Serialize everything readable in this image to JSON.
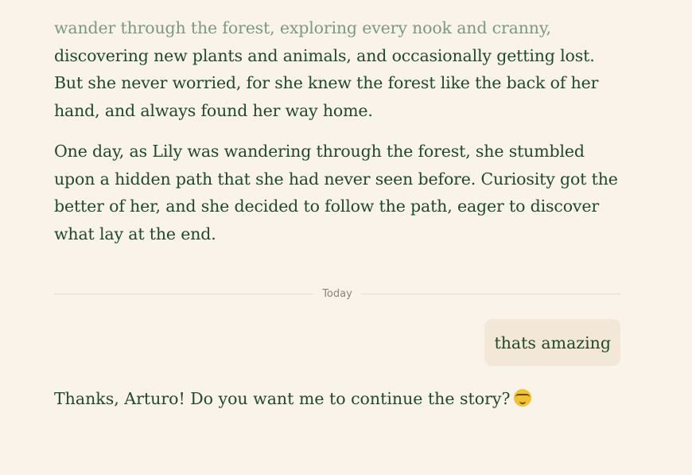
{
  "messages": {
    "assistant_story": {
      "faded_line": "wander through the forest, exploring every nook and cranny,",
      "paragraph1_rest": "discovering new plants and animals, and occasionally getting lost. But she never worried, for she knew the forest like the back of her hand, and always found her way home.",
      "paragraph2": "One day, as Lily was wandering through the forest, she stumbled upon a hidden path that she had never seen before. Curiosity got the better of her, and she decided to follow the path, eager to discover what lay at the end."
    },
    "divider_label": "Today",
    "user_message": "thats amazing",
    "assistant_reply": "Thanks, Arturo! Do you want me to continue the story?",
    "reply_emoji": "nerd-face-emoji"
  },
  "colors": {
    "background": "#f9f3ea",
    "text": "#1f4a2c",
    "faded_text": "#7b9a82",
    "user_bubble": "#f3e7d8",
    "divider": "#e3dccd"
  }
}
